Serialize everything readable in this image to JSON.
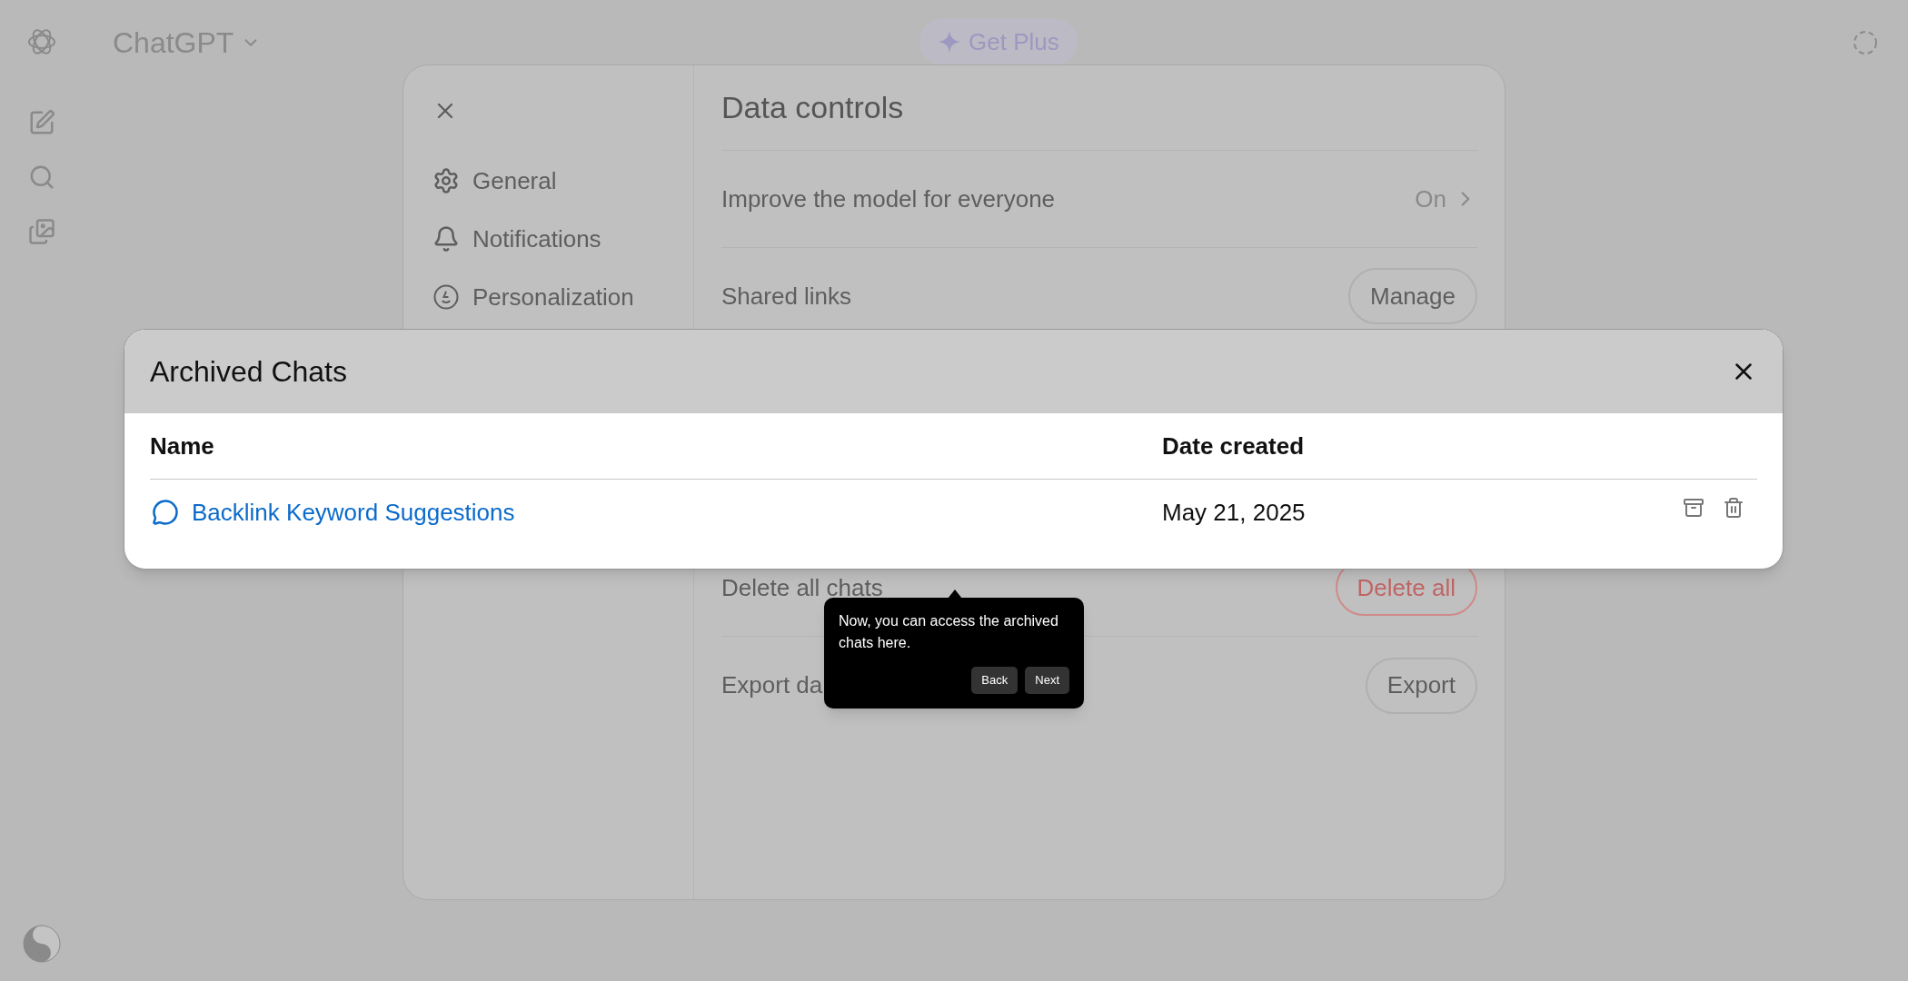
{
  "app": {
    "title": "ChatGPT",
    "upgrade_button": "Get Plus"
  },
  "settings": {
    "nav": [
      {
        "label": "General"
      },
      {
        "label": "Notifications"
      },
      {
        "label": "Personalization"
      }
    ],
    "section_title": "Data controls",
    "rows": [
      {
        "kind": "link",
        "label": "Improve the model for everyone",
        "value": "On"
      },
      {
        "kind": "button",
        "label": "Shared links",
        "button": "Manage",
        "danger": false
      },
      {
        "kind": "button",
        "label": "Delete all chats",
        "button": "Delete all",
        "danger": true
      },
      {
        "kind": "button",
        "label": "Export da",
        "button": "Export",
        "danger": false
      }
    ]
  },
  "archived_dialog": {
    "title": "Archived Chats",
    "columns": [
      "Name",
      "Date created"
    ],
    "rows": [
      {
        "name": "Backlink Keyword Suggestions",
        "date": "May 21, 2025"
      }
    ]
  },
  "tour_tooltip": {
    "text": "Now, you can access the archived chats here.",
    "buttons": [
      "Back",
      "Next"
    ]
  }
}
